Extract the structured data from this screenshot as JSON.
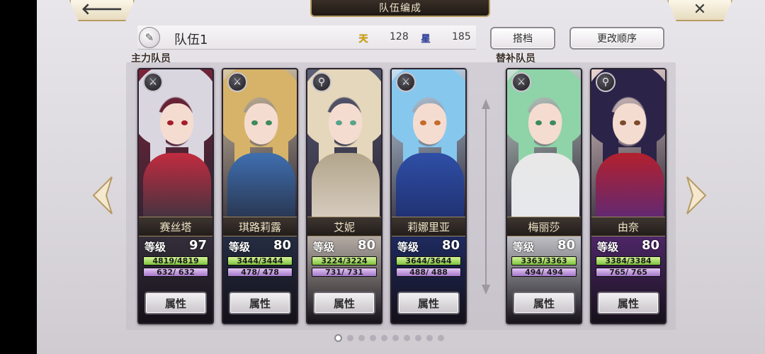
{
  "header": {
    "back_glyph": "🡐",
    "title": "队伍编成",
    "close_glyph": "✕"
  },
  "team": {
    "name": "队伍1",
    "stat1_icon_text": "天",
    "stat1_value": "128",
    "stat2_icon_text": "星",
    "stat2_value": "185"
  },
  "buttons": {
    "partner": "搭档",
    "change_order": "更改顺序"
  },
  "sections": {
    "main": "主力队员",
    "sub": "替补队员"
  },
  "members": [
    {
      "name": "赛丝塔",
      "level_label": "等级",
      "level": "97",
      "hp": "4819/4819",
      "hp_pct": 1.0,
      "mp": "632/ 632",
      "mp_pct": 1.0,
      "attr": "属性",
      "badge": "sword-icon",
      "badge_glyph": "⚔",
      "colors": {
        "hair": "#d9d6e0",
        "accent": "#c22b3f",
        "body": "#3a3440",
        "eye": "#a61d2a",
        "bg": "#7b2338"
      }
    },
    {
      "name": "琪路莉露",
      "level_label": "等级",
      "level": "80",
      "hp": "3444/3444",
      "hp_pct": 1.0,
      "mp": "478/ 478",
      "mp_pct": 1.0,
      "attr": "属性",
      "badge": "sword-icon",
      "badge_glyph": "⚔",
      "colors": {
        "hair": "#d7b36a",
        "accent": "#3f6fb0",
        "body": "#27324a",
        "eye": "#3e8a5b",
        "bg": "#d8c9a8"
      }
    },
    {
      "name": "艾妮",
      "level_label": "等级",
      "level": "80",
      "hp": "3224/3224",
      "hp_pct": 1.0,
      "mp": "731/ 731",
      "mp_pct": 1.0,
      "attr": "属性",
      "badge": "magic-icon",
      "badge_glyph": "⚲",
      "colors": {
        "hair": "#e4d7bb",
        "accent": "#b3a58b",
        "body": "#d9cfc3",
        "eye": "#58a38a",
        "bg": "#5b5f78"
      }
    },
    {
      "name": "莉娜里亚",
      "level_label": "等级",
      "level": "80",
      "hp": "3644/3644",
      "hp_pct": 1.0,
      "mp": "488/ 488",
      "mp_pct": 1.0,
      "attr": "属性",
      "badge": "sword-icon",
      "badge_glyph": "⚔",
      "colors": {
        "hair": "#86c7ee",
        "accent": "#2f4fa6",
        "body": "#1f2f6e",
        "eye": "#c56b2b",
        "bg": "#c9e1f2"
      }
    },
    {
      "name": "梅丽莎",
      "level_label": "等级",
      "level": "80",
      "hp": "3363/3363",
      "hp_pct": 1.0,
      "mp": "494/ 494",
      "mp_pct": 1.0,
      "attr": "属性",
      "badge": "sword-icon",
      "badge_glyph": "⚔",
      "colors": {
        "hair": "#8fd3a8",
        "accent": "#e8e8e8",
        "body": "#e6e8ec",
        "eye": "#3d8a62",
        "bg": "#cfe3d8"
      }
    },
    {
      "name": "由奈",
      "level_label": "等级",
      "level": "80",
      "hp": "3384/3384",
      "hp_pct": 1.0,
      "mp": "765/ 765",
      "mp_pct": 1.0,
      "attr": "属性",
      "badge": "magic-icon",
      "badge_glyph": "⚲",
      "colors": {
        "hair": "#2b2448",
        "accent": "#b3202e",
        "body": "#5a2a78",
        "eye": "#7b4b2a",
        "bg": "#e9d4d2"
      }
    }
  ],
  "pager": {
    "count": 10,
    "active": 0
  }
}
